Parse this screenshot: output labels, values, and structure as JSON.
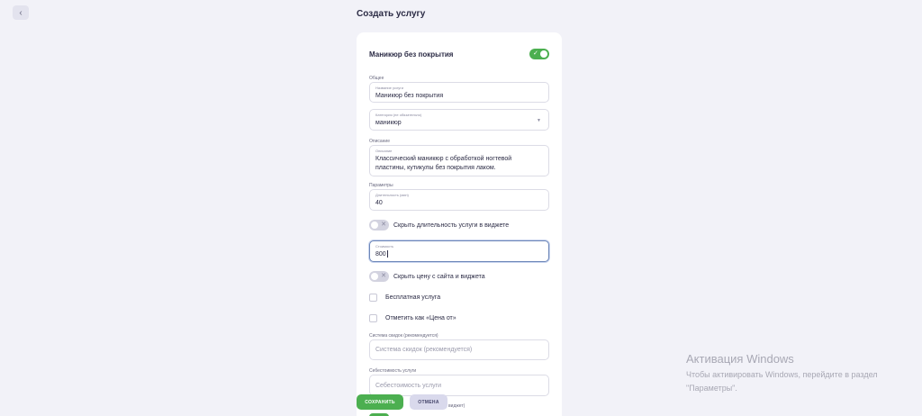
{
  "header": {
    "back_icon": "chevron-left-icon",
    "title": "Создать услугу"
  },
  "card": {
    "title": "Маникюр без покрытия",
    "active_toggle": true,
    "sections": {
      "general": "Общее",
      "description": "Описание",
      "parameters": "Параметры"
    },
    "fields": {
      "name": {
        "label": "Название услуги",
        "value": "Маникюр без покрытия"
      },
      "category": {
        "label": "Категория (не обязательно)",
        "value": "маникюр"
      },
      "description": {
        "label": "Описание",
        "value": "Классический маникюр с обработкой ногтевой пластины, кутикулы без покрытия лаком."
      },
      "duration": {
        "label": "Длительность (мин)",
        "value": "40"
      },
      "price": {
        "label": "Стоимость",
        "value": "800"
      },
      "discount": {
        "label": "Система скидок (рекомендуется)",
        "placeholder": "Система скидок (рекомендуется)"
      },
      "cost": {
        "label": "Себестоимость услуги",
        "placeholder": "Себестоимость услуги"
      }
    },
    "toggles": {
      "hide_duration": {
        "label": "Скрыть длительность услуги в виджете",
        "on": false
      },
      "hide_price": {
        "label": "Скрыть цену с сайта и виджета",
        "on": false
      }
    },
    "checkboxes": {
      "free": {
        "label": "Бесплатная услуга",
        "checked": false
      },
      "price_from": {
        "label": "Отметить как «Цена от»",
        "checked": false
      }
    },
    "cut_off_label": "виджет)"
  },
  "actions": {
    "save": "СОХРАНИТЬ",
    "cancel": "ОТМЕНА"
  },
  "watermark": {
    "title": "Активация Windows",
    "text": "Чтобы активировать Windows, перейдите в раздел \"Параметры\"."
  },
  "colors": {
    "accent": "#4caf50",
    "background": "#f2f2f8",
    "text": "#2b2b45"
  }
}
